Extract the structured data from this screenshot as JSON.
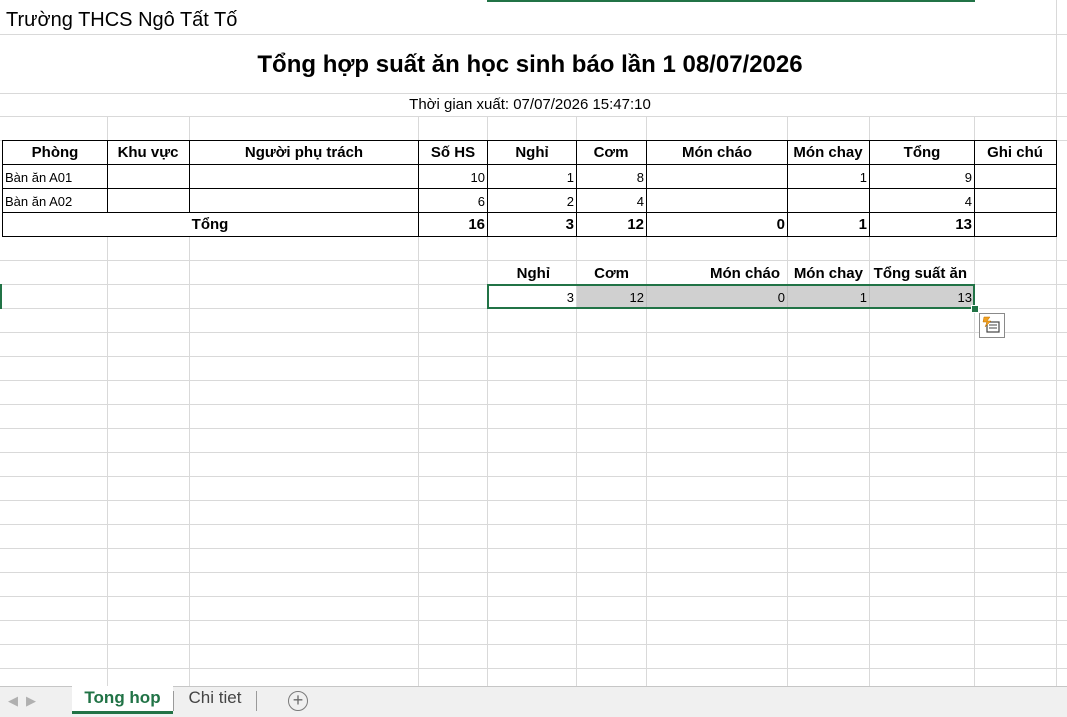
{
  "header": {
    "school": "Trường THCS Ngô Tất Tố",
    "title": "Tổng hợp suất ăn học sinh báo lần 1 08/07/2026",
    "export_time": "Thời gian xuất: 07/07/2026 15:47:10"
  },
  "table": {
    "columns": [
      "Phòng",
      "Khu vực",
      "Người phụ trách",
      "Số HS",
      "Nghỉ",
      "Cơm",
      "Món cháo",
      "Món chay",
      "Tổng",
      "Ghi chú"
    ],
    "rows": [
      {
        "phong": "Bàn ăn A01",
        "khu_vuc": "",
        "nguoi_phu_trach": "",
        "so_hs": "10",
        "nghi": "1",
        "com": "8",
        "mon_chao": "",
        "mon_chay": "1",
        "tong": "9",
        "ghi_chu": ""
      },
      {
        "phong": "Bàn ăn A02",
        "khu_vuc": "",
        "nguoi_phu_trach": "",
        "so_hs": "6",
        "nghi": "2",
        "com": "4",
        "mon_chao": "",
        "mon_chay": "",
        "tong": "4",
        "ghi_chu": ""
      }
    ],
    "total": {
      "label": "Tổng",
      "so_hs": "16",
      "nghi": "3",
      "com": "12",
      "mon_chao": "0",
      "mon_chay": "1",
      "tong": "13"
    }
  },
  "summary": {
    "headers": [
      "Nghỉ",
      "Cơm",
      "Món cháo",
      "Món chay",
      "Tổng suất ăn"
    ],
    "values": [
      "3",
      "12",
      "0",
      "1",
      "13"
    ]
  },
  "tabs": [
    {
      "label": "Tong hop",
      "active": true
    },
    {
      "label": "Chi tiet",
      "active": false
    }
  ],
  "icons": {
    "quick_analysis": "quick-analysis-icon",
    "add_sheet": "plus-circle-icon",
    "nav_prev": "arrow-left-icon",
    "nav_next": "arrow-right-icon"
  },
  "colors": {
    "accent": "#217346",
    "gridline": "#d9d9d9",
    "selection_fill": "#d0d0d0"
  }
}
